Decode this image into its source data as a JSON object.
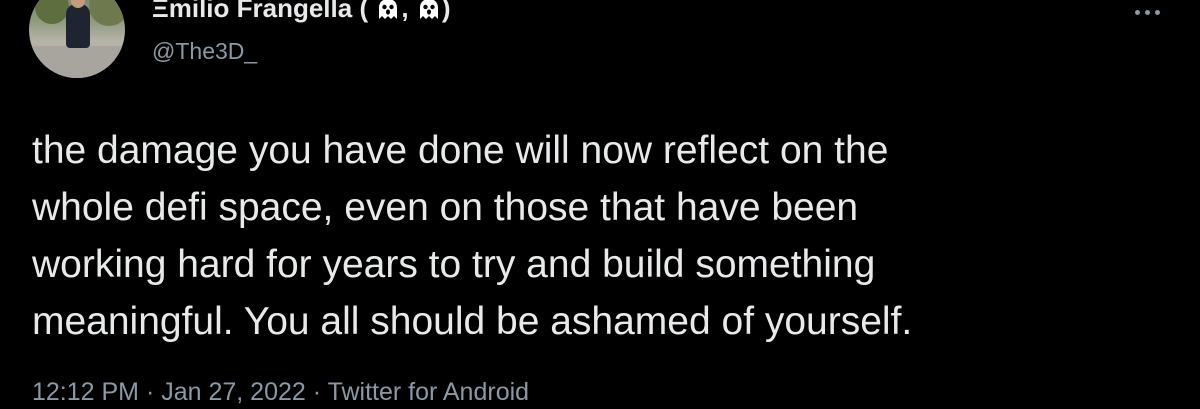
{
  "author": {
    "display_name": "Ξmilio Frangella (",
    "display_name_sep": ",",
    "display_name_end": ")",
    "handle": "@The3D_"
  },
  "tweet": {
    "lines": [
      "the damage you have done will now reflect on the",
      "whole defi space, even on those that have been",
      "working hard for years to try and build something",
      "meaningful. You all should be ashamed of yourself."
    ]
  },
  "meta": {
    "time": "12:12 PM",
    "sep1": " · ",
    "date": "Jan 27, 2022",
    "sep2": " · ",
    "source": "Twitter for Android"
  },
  "icons": {
    "more": "more-horizontal-icon",
    "emoji": "ghost-icon"
  },
  "colors": {
    "background": "#000000",
    "text": "#e7e9ea",
    "secondary": "#8b98a5"
  }
}
